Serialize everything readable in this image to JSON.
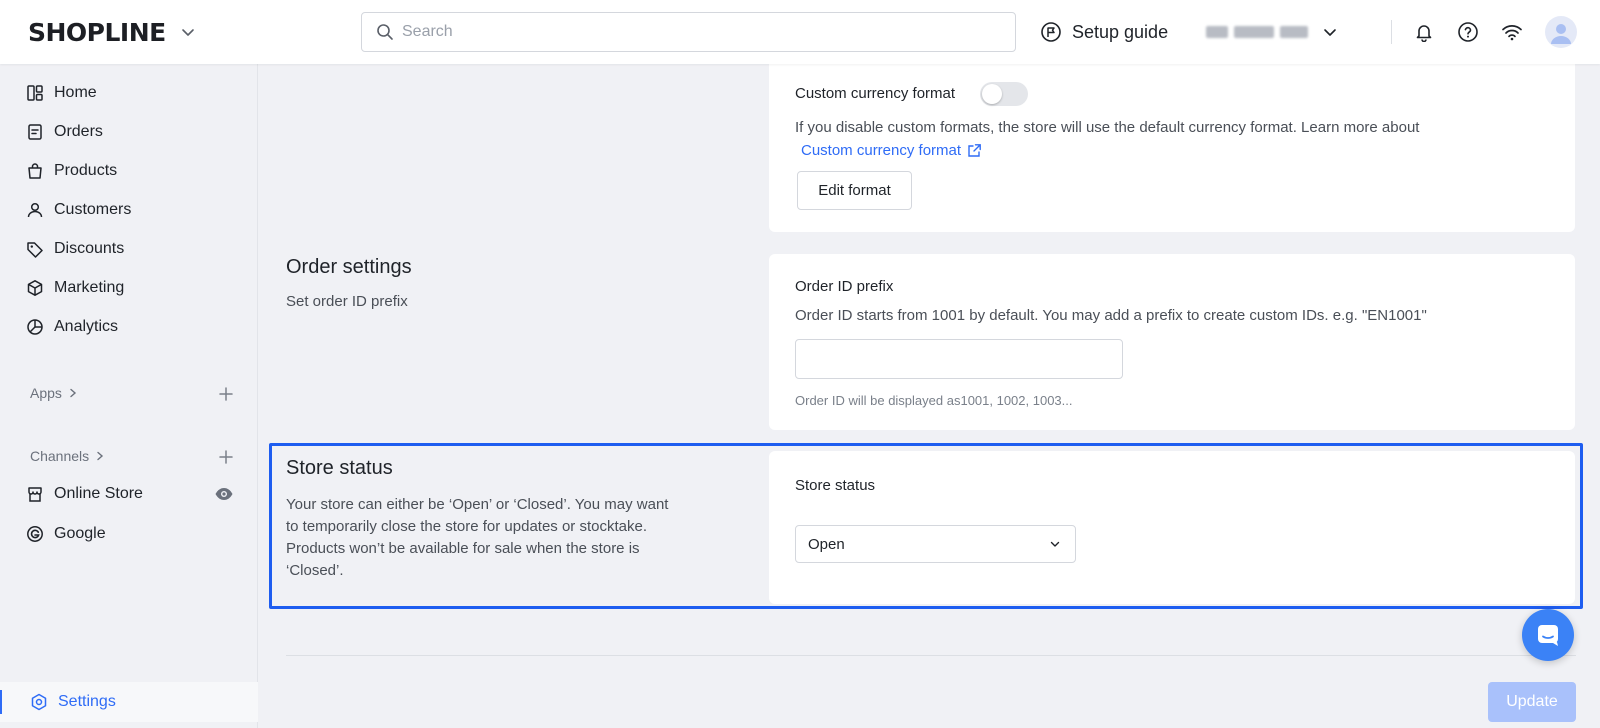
{
  "header": {
    "logo_text": "SHOPLINE",
    "search_placeholder": "Search",
    "setup_guide_label": "Setup guide"
  },
  "sidebar": {
    "items": [
      {
        "label": "Home"
      },
      {
        "label": "Orders"
      },
      {
        "label": "Products"
      },
      {
        "label": "Customers"
      },
      {
        "label": "Discounts"
      },
      {
        "label": "Marketing"
      },
      {
        "label": "Analytics"
      }
    ],
    "apps_label": "Apps",
    "channels_label": "Channels",
    "channels": [
      {
        "label": "Online Store"
      },
      {
        "label": "Google"
      }
    ],
    "settings_label": "Settings"
  },
  "currency": {
    "label": "Custom currency format",
    "toggle_on": false,
    "help": "If you disable custom formats, the store will use the default currency format. Learn more about",
    "link_label": "Custom currency format",
    "edit_button": "Edit format"
  },
  "order_settings": {
    "title": "Order settings",
    "subtitle": "Set order ID prefix",
    "field_label": "Order ID prefix",
    "help": "Order ID starts from 1001 by default. You may add a prefix to create custom IDs. e.g. \"EN1001\"",
    "input_value": "",
    "hint": "Order ID will be displayed as1001, 1002, 1003..."
  },
  "store_status": {
    "title": "Store status",
    "description_lines": [
      "Your store can either be ‘Open’ or ‘Closed’. You may want",
      "to temporarily close the store for updates or stocktake.",
      "Products won’t be available for sale when the store is",
      "‘Closed’."
    ],
    "field_label": "Store status",
    "selected_value": "Open"
  },
  "footer": {
    "update_button": "Update"
  },
  "colors": {
    "accent": "#2f6cf6",
    "highlight_border": "#1e5df0",
    "update_disabled": "#a9c1fb"
  },
  "icons": {
    "logo_dropdown": "chevron-down-icon",
    "search": "search-icon",
    "setup": "flag-icon",
    "notifications": "bell-icon",
    "help": "question-icon",
    "network": "wifi-icon",
    "chat": "chat-icon"
  }
}
